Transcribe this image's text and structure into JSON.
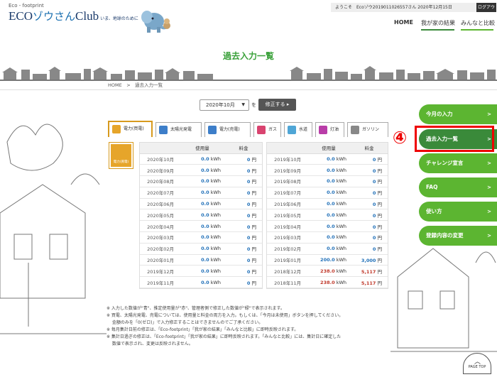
{
  "header": {
    "logo_small": "Eco - footprint",
    "logo_eco": "ECO",
    "logo_zou": "ゾウさん",
    "logo_club": "Club",
    "logo_tag": "いま、地球のために",
    "welcome": "ようこそ　Ecoゾウ2019011026557さん 2020年12月15日",
    "logout": "ログアウト",
    "nav": [
      "HOME",
      "我が家の結果",
      "みんなと比較"
    ]
  },
  "page": {
    "title": "過去入力一覧",
    "breadcrumb": "HOME　>　過去入力一覧"
  },
  "controls": {
    "month": "2020年10月",
    "wo": "を",
    "fix_button": "修正する"
  },
  "tabs": [
    {
      "label": "電力(買電)",
      "color": "#e6a52a"
    },
    {
      "label": "太陽光発電",
      "color": "#3d7ec9"
    },
    {
      "label": "電力(売電)",
      "color": "#3d7ec9"
    },
    {
      "label": "ガス",
      "color": "#d9436f"
    },
    {
      "label": "水道",
      "color": "#4fa6d6"
    },
    {
      "label": "灯油",
      "color": "#b93da8"
    },
    {
      "label": "ガソリン",
      "color": "#888888"
    }
  ],
  "side_icon_label": "電力(買電)",
  "table_headers": {
    "usage": "使用量",
    "fee": "料金"
  },
  "left_rows": [
    {
      "month": "2020年10月",
      "usage": "0.0",
      "unit": "kWh",
      "fee": "0",
      "yen": "円"
    },
    {
      "month": "2020年09月",
      "usage": "0.0",
      "unit": "kWh",
      "fee": "0",
      "yen": "円"
    },
    {
      "month": "2020年08月",
      "usage": "0.0",
      "unit": "kWh",
      "fee": "0",
      "yen": "円"
    },
    {
      "month": "2020年07月",
      "usage": "0.0",
      "unit": "kWh",
      "fee": "0",
      "yen": "円"
    },
    {
      "month": "2020年06月",
      "usage": "0.0",
      "unit": "kWh",
      "fee": "0",
      "yen": "円"
    },
    {
      "month": "2020年05月",
      "usage": "0.0",
      "unit": "kWh",
      "fee": "0",
      "yen": "円"
    },
    {
      "month": "2020年04月",
      "usage": "0.0",
      "unit": "kWh",
      "fee": "0",
      "yen": "円"
    },
    {
      "month": "2020年03月",
      "usage": "0.0",
      "unit": "kWh",
      "fee": "0",
      "yen": "円"
    },
    {
      "month": "2020年02月",
      "usage": "0.0",
      "unit": "kWh",
      "fee": "0",
      "yen": "円"
    },
    {
      "month": "2020年01月",
      "usage": "0.0",
      "unit": "kWh",
      "fee": "0",
      "yen": "円"
    },
    {
      "month": "2019年12月",
      "usage": "0.0",
      "unit": "kWh",
      "fee": "0",
      "yen": "円"
    },
    {
      "month": "2019年11月",
      "usage": "0.0",
      "unit": "kWh",
      "fee": "0",
      "yen": "円"
    }
  ],
  "right_rows": [
    {
      "month": "2019年10月",
      "usage": "0.0",
      "unit": "kWh",
      "fee": "0",
      "yen": "円",
      "red": false
    },
    {
      "month": "2019年09月",
      "usage": "0.0",
      "unit": "kWh",
      "fee": "0",
      "yen": "円",
      "red": false
    },
    {
      "month": "2019年08月",
      "usage": "0.0",
      "unit": "kWh",
      "fee": "0",
      "yen": "円",
      "red": false
    },
    {
      "month": "2019年07月",
      "usage": "0.0",
      "unit": "kWh",
      "fee": "0",
      "yen": "円",
      "red": false
    },
    {
      "month": "2019年06月",
      "usage": "0.0",
      "unit": "kWh",
      "fee": "0",
      "yen": "円",
      "red": false
    },
    {
      "month": "2019年05月",
      "usage": "0.0",
      "unit": "kWh",
      "fee": "0",
      "yen": "円",
      "red": false
    },
    {
      "month": "2019年04月",
      "usage": "0.0",
      "unit": "kWh",
      "fee": "0",
      "yen": "円",
      "red": false
    },
    {
      "month": "2019年03月",
      "usage": "0.0",
      "unit": "kWh",
      "fee": "0",
      "yen": "円",
      "red": false
    },
    {
      "month": "2019年02月",
      "usage": "0.0",
      "unit": "kWh",
      "fee": "0",
      "yen": "円",
      "red": false
    },
    {
      "month": "2019年01月",
      "usage": "200.0",
      "unit": "kWh",
      "fee": "3,000",
      "yen": "円",
      "red": false
    },
    {
      "month": "2018年12月",
      "usage": "238.0",
      "unit": "kWh",
      "fee": "5,117",
      "yen": "円",
      "red": true
    },
    {
      "month": "2018年11月",
      "usage": "238.0",
      "unit": "kWh",
      "fee": "5,117",
      "yen": "円",
      "red": true
    }
  ],
  "notes": [
    "※ 入力した数値が\"青\"、推定使用量が\"赤\"、管理者側で修正した数値が\"緑\"で表示されます。",
    "※ 買電、太陽光発電、売電については、使用量と料金の両方を入力。もしくは、「今月は未使用」ボタンを押してください。",
    "　 金額のみを「0(ゼロ)」で入力修正することはできませんのでご了承ください。",
    "※ 毎月集計日前の修正は、「Eco-footprint」「我が家の結果」「みんなと比較」に即時反映されます。",
    "※ 集計日過ぎの修正は、「Eco-footprint」「我が家の結果」に即時反映されます。「みんなと比較」には、集計日に確定した",
    "　 数値で表示され、変更は反映されません。"
  ],
  "side_menu": [
    "今月の入力",
    "過去入力一覧",
    "チャレンジ宣言",
    "FAQ",
    "使い方",
    "登録内容の変更"
  ],
  "annotation_number": "④",
  "page_top": "PAGE TOP"
}
